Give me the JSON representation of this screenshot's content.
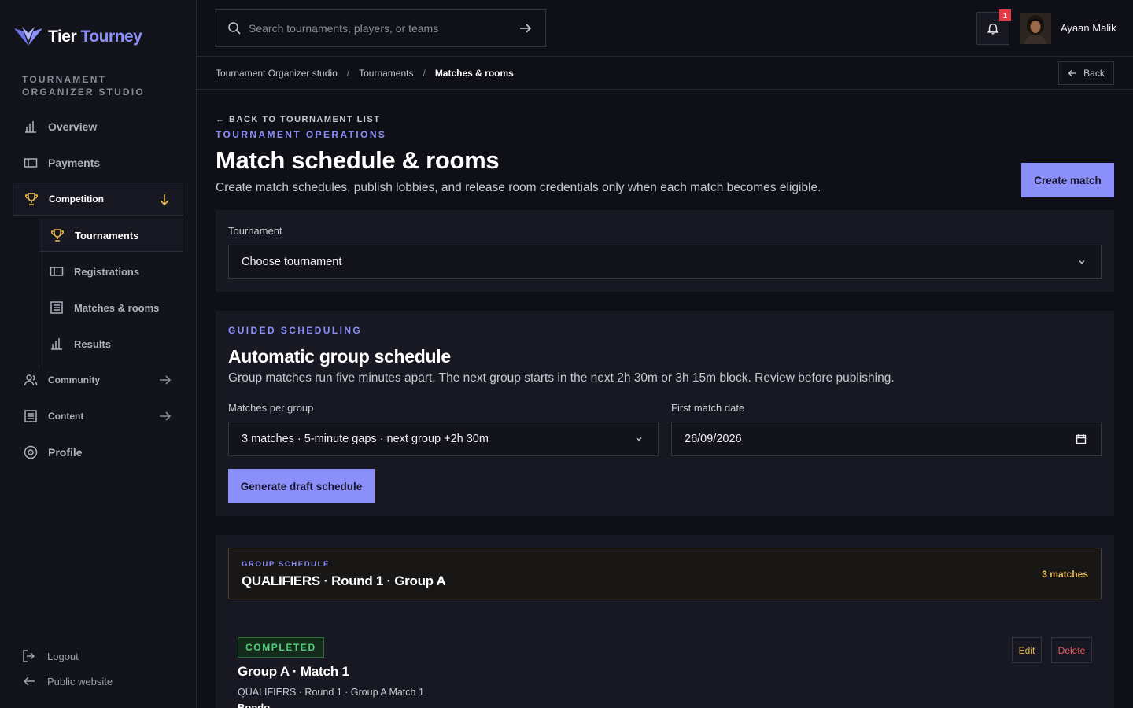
{
  "brand": {
    "name_part1": "Tier",
    "name_part2": "Tourney",
    "accent": "#8b8ff9"
  },
  "sidebar": {
    "section_label": "TOURNAMENT ORGANIZER STUDIO",
    "items": [
      {
        "label": "Overview",
        "icon": "bar-chart-icon"
      },
      {
        "label": "Payments",
        "icon": "ticket-icon"
      },
      {
        "label": "Competition",
        "icon": "trophy-icon",
        "expanded": true
      },
      {
        "label": "Community",
        "icon": "users-icon"
      },
      {
        "label": "Content",
        "icon": "document-icon"
      },
      {
        "label": "Profile",
        "icon": "settings-icon"
      }
    ],
    "sub_items": [
      {
        "label": "Tournaments",
        "icon": "trophy-icon",
        "active": true
      },
      {
        "label": "Registrations",
        "icon": "ticket-icon"
      },
      {
        "label": "Matches & rooms",
        "icon": "list-icon"
      },
      {
        "label": "Results",
        "icon": "bar-chart-icon"
      }
    ],
    "footer": {
      "logout": "Logout",
      "public_website": "Public website"
    }
  },
  "topbar": {
    "search_placeholder": "Search tournaments, players, or teams",
    "notification_count": "1",
    "user_name": "Ayaan Malik"
  },
  "breadcrumb": {
    "items": [
      "Tournament Organizer studio",
      "Tournaments",
      "Matches & rooms"
    ],
    "back_label": "Back"
  },
  "main": {
    "back_link": "← BACK TO TOURNAMENT LIST",
    "eyebrow": "TOURNAMENT OPERATIONS",
    "title": "Match schedule & rooms",
    "subtitle": "Create match schedules, publish lobbies, and release room credentials only when each match becomes eligible.",
    "create_button": "Create match",
    "tournament_label": "Tournament",
    "tournament_value": "Choose tournament"
  },
  "guided": {
    "eyebrow": "GUIDED SCHEDULING",
    "title": "Automatic group schedule",
    "subtitle": "Group matches run five minutes apart. The next group starts in the next 2h 30m or 3h 15m block. Review before publishing.",
    "matches_label": "Matches per group",
    "matches_value": "3 matches · 5-minute gaps · next group +2h 30m",
    "date_label": "First match date",
    "date_value": "26/09/2026",
    "generate_button": "Generate draft schedule"
  },
  "group": {
    "eyebrow": "GROUP SCHEDULE",
    "title": "QUALIFIERS · Round 1 · Group A",
    "count": "3 matches"
  },
  "match": {
    "status": "COMPLETED",
    "title": "Group A · Match 1",
    "subtitle": "QUALIFIERS · Round 1 · Group A Match 1",
    "map": "Bondo",
    "edit_label": "Edit",
    "delete_label": "Delete"
  }
}
